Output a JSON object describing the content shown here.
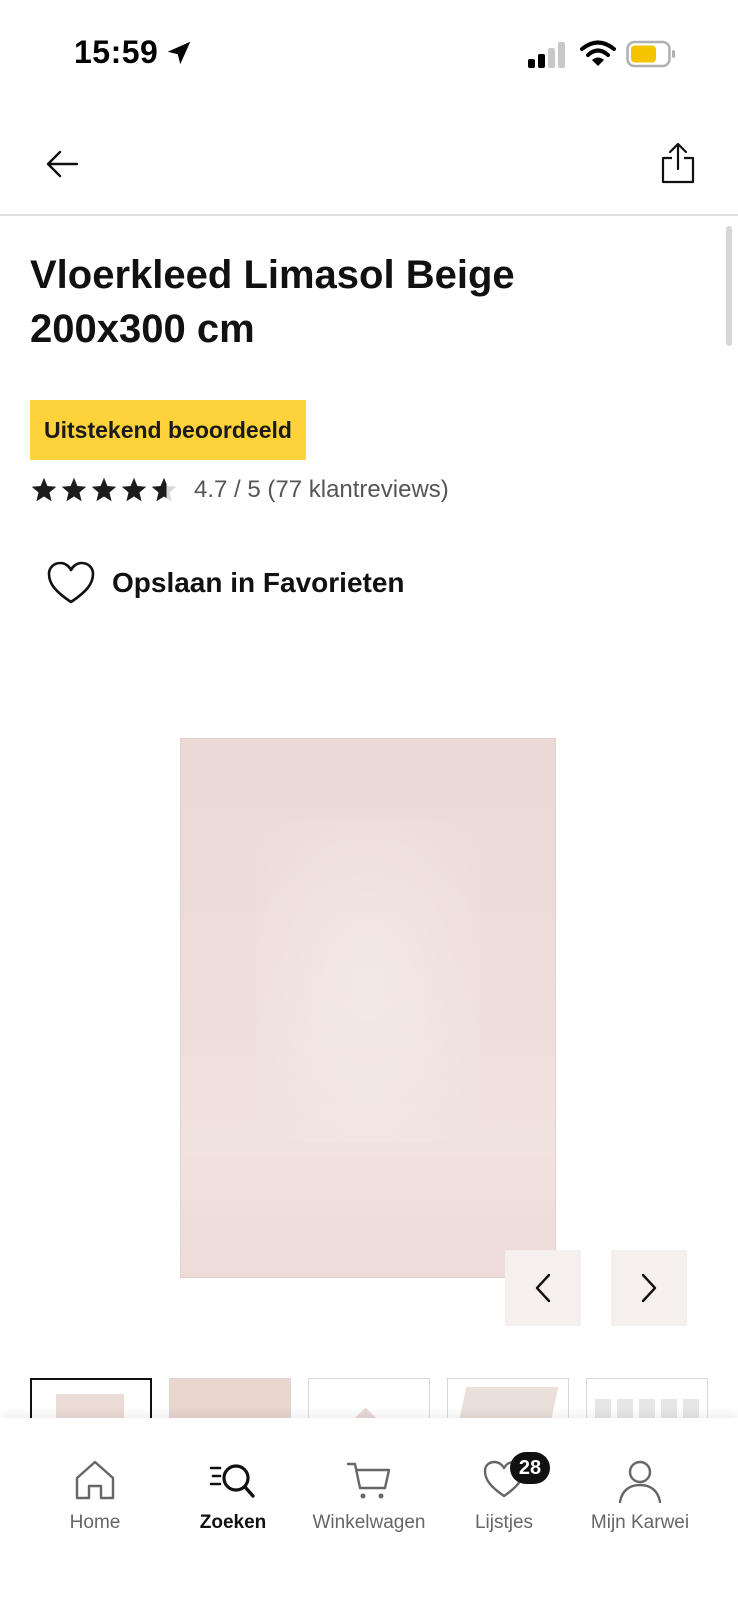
{
  "status_bar": {
    "time": "15:59",
    "icons": [
      "location-arrow-icon",
      "signal-icon",
      "wifi-icon",
      "battery-icon"
    ],
    "battery_color": "#f5c400"
  },
  "header": {
    "back_icon": "arrow-left-icon",
    "share_icon": "share-icon"
  },
  "product": {
    "title": "Vloerkleed Limasol Beige 200x300 cm",
    "badge": "Uitstekend beoordeeld",
    "badge_color": "#fdd23a",
    "rating": {
      "stars_filled": 4.7,
      "stars_max": 5,
      "text": "4.7 / 5 (77 klantreviews)"
    },
    "favorite_label": "Opslaan in Favorieten",
    "image_alt_color": "#ecdcd7"
  },
  "carousel": {
    "prev_icon": "chevron-left-icon",
    "next_icon": "chevron-right-icon",
    "thumbnails_count": 5,
    "active_thumbnail": 1
  },
  "tab_bar": {
    "tabs": [
      {
        "label": "Home",
        "icon": "home-icon",
        "active": false
      },
      {
        "label": "Zoeken",
        "icon": "search-icon",
        "active": true
      },
      {
        "label": "Winkelwagen",
        "icon": "cart-icon",
        "active": false
      },
      {
        "label": "Lijstjes",
        "icon": "heart-icon",
        "active": false,
        "badge": "28"
      },
      {
        "label": "Mijn Karwei",
        "icon": "user-icon",
        "active": false
      }
    ]
  }
}
